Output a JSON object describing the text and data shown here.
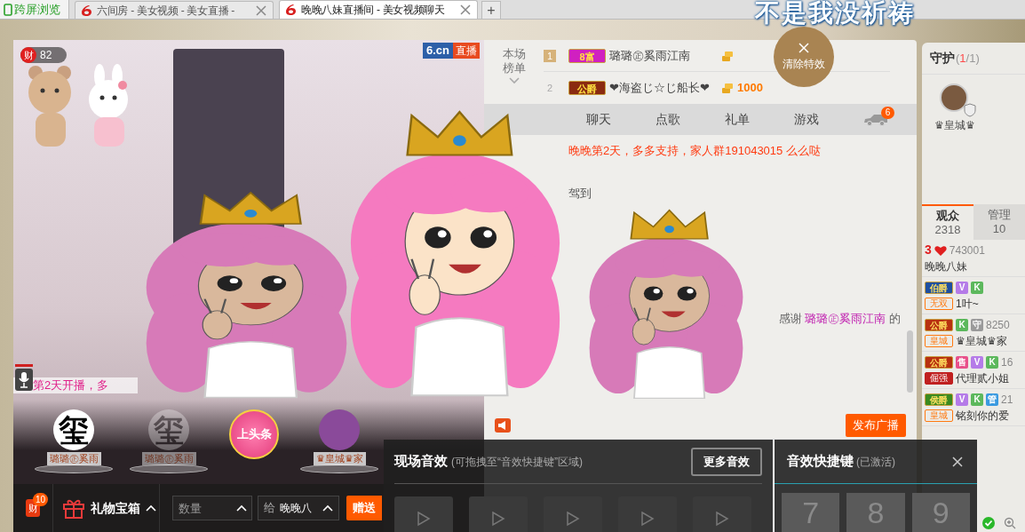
{
  "browser": {
    "sync_button": "跨屏浏览",
    "tabs": [
      {
        "title": "六间房 - 美女视频 - 美女直播 -",
        "selected": false
      },
      {
        "title": "晚晚八妹直播间 - 美女视频聊天",
        "selected": true
      }
    ],
    "new_tab": "+"
  },
  "effect_text": "不是我没祈祷",
  "video": {
    "wealth_label": "财",
    "wealth_count": "82",
    "logo": "6.cn",
    "logo_tag": "直播",
    "ticker": "第2天开播，多",
    "gift_stage": [
      {
        "kind": "user",
        "avatar_text": "玺",
        "caption": "璐璐㊣奚雨",
        "dimmed": false
      },
      {
        "kind": "user",
        "avatar_text": "玺",
        "caption": "璐璐㊣奚雨",
        "dimmed": true
      },
      {
        "kind": "headline",
        "caption": "上头条"
      },
      {
        "kind": "user",
        "caption": "♛皇城♛家",
        "dimmed": false
      }
    ]
  },
  "gift_bar": {
    "wealth_label": "财",
    "wealth_badge": "10",
    "gift_box": "礼物宝箱",
    "quantity_placeholder": "数量",
    "to_label": "给",
    "recipient": "晚晚八",
    "send": "赠送"
  },
  "ranking": {
    "title": "本场榜单",
    "rows": [
      {
        "rank": "1",
        "badge": "8富",
        "color": "#d020c0",
        "name": "璐璐㊣奚雨江南"
      },
      {
        "rank": "2",
        "badge": "公爵",
        "color": "#8a2a10",
        "name": "❤海盗じ☆じ船长❤",
        "amount": "1000"
      }
    ]
  },
  "clear_effects": "清除特效",
  "chat_tabs": [
    {
      "label": "聊天",
      "selected": false
    },
    {
      "label": "点歌",
      "selected": false
    },
    {
      "label": "礼单",
      "selected": false
    },
    {
      "label": "游戏",
      "selected": false
    }
  ],
  "car_badge": "6",
  "messages": [
    {
      "kind": "notice",
      "text": "晚晚第2天，多多支持，家人群191043015 么么哒"
    },
    {
      "kind": "arrival",
      "text": "驾到"
    },
    {
      "kind": "thanks",
      "prefix": "感谢",
      "name": "璐璐㊣奚雨江南",
      "suffix": "的"
    }
  ],
  "broadcast_button": "发布广播",
  "sound_panel": {
    "title": "现场音效",
    "hint": "(可拖拽至“音效快捷键”区域)",
    "more": "更多音效",
    "slots": [
      {
        "kind": "play"
      },
      {
        "kind": "play"
      },
      {
        "kind": "play"
      },
      {
        "kind": "play"
      },
      {
        "kind": "play"
      }
    ]
  },
  "shortcut_panel": {
    "title": "音效快捷键",
    "status": "(已激活)",
    "keys": [
      "7",
      "8",
      "9"
    ]
  },
  "sidebar": {
    "guard_title": "守护",
    "guard_prefix": "(",
    "guard_count": "1",
    "guard_suffix": "/1)",
    "guards": [
      {
        "name": "♛皇城♛"
      }
    ],
    "tabs": [
      {
        "label": "观众",
        "count": "2318",
        "selected": true
      },
      {
        "label": "管理",
        "count": "10",
        "selected": false
      }
    ],
    "viewers": [
      {
        "level": "3",
        "number": "743001",
        "name": "晚晚八妹"
      },
      {
        "rank": {
          "text": "伯爵",
          "color": "#1e4fa0"
        },
        "badges": [
          {
            "text": "V",
            "color": "#b57be8"
          },
          {
            "text": "K",
            "color": "#5cb85c"
          }
        ],
        "tag": {
          "kind": "outline",
          "text": "无双"
        },
        "name": "1叶~"
      },
      {
        "rank": {
          "text": "公爵",
          "color": "#b83010"
        },
        "badges": [
          {
            "text": "K",
            "color": "#5cb85c"
          },
          {
            "text": "守",
            "color": "#9a9a9a"
          }
        ],
        "number": "8250",
        "tag": {
          "kind": "outline",
          "text": "皇城"
        },
        "name": "♛皇城♛家"
      },
      {
        "rank": {
          "text": "公爵",
          "color": "#b83010"
        },
        "badges": [
          {
            "text": "售",
            "color": "#e8508a"
          },
          {
            "text": "V",
            "color": "#b57be8"
          },
          {
            "text": "K",
            "color": "#5cb85c"
          }
        ],
        "number": "16",
        "tag": {
          "kind": "filled",
          "text": "倔强"
        },
        "name": "代理贰小姐"
      },
      {
        "rank": {
          "text": "侯爵",
          "color": "#3a8a20"
        },
        "badges": [
          {
            "text": "V",
            "color": "#b57be8"
          },
          {
            "text": "K",
            "color": "#5cb85c"
          },
          {
            "text": "管",
            "color": "#3a9ae0"
          }
        ],
        "number": "21",
        "tag": {
          "kind": "outline",
          "text": "皇城"
        },
        "name": "铭刻你的爱"
      }
    ]
  }
}
